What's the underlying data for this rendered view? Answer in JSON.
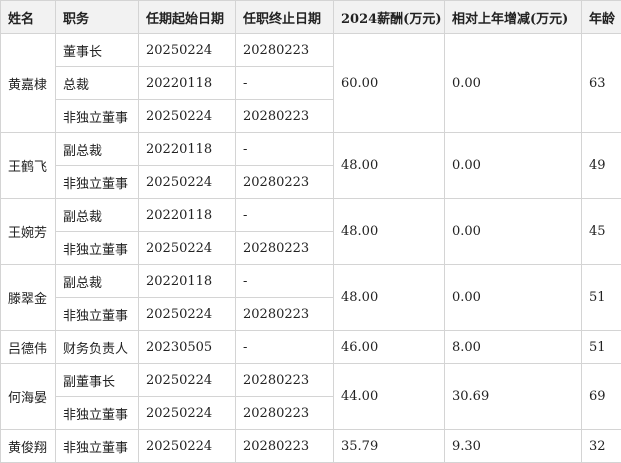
{
  "headers": {
    "name": "姓名",
    "position": "职务",
    "start": "任期起始日期",
    "end": "任职终止日期",
    "salary": "2024薪酬(万元)",
    "change": "相对上年增减(万元)",
    "age": "年龄"
  },
  "executives": [
    {
      "name": "黄嘉棣",
      "salary": "60.00",
      "change": "0.00",
      "age": "63",
      "roles": [
        {
          "position": "董事长",
          "start": "20250224",
          "end": "20280223"
        },
        {
          "position": "总裁",
          "start": "20220118",
          "end": "-"
        },
        {
          "position": "非独立董事",
          "start": "20250224",
          "end": "20280223"
        }
      ]
    },
    {
      "name": "王鹤飞",
      "salary": "48.00",
      "change": "0.00",
      "age": "49",
      "roles": [
        {
          "position": "副总裁",
          "start": "20220118",
          "end": "-"
        },
        {
          "position": "非独立董事",
          "start": "20250224",
          "end": "20280223"
        }
      ]
    },
    {
      "name": "王婉芳",
      "salary": "48.00",
      "change": "0.00",
      "age": "45",
      "roles": [
        {
          "position": "副总裁",
          "start": "20220118",
          "end": "-"
        },
        {
          "position": "非独立董事",
          "start": "20250224",
          "end": "20280223"
        }
      ]
    },
    {
      "name": "滕翠金",
      "salary": "48.00",
      "change": "0.00",
      "age": "51",
      "roles": [
        {
          "position": "副总裁",
          "start": "20220118",
          "end": "-"
        },
        {
          "position": "非独立董事",
          "start": "20250224",
          "end": "20280223"
        }
      ]
    },
    {
      "name": "吕德伟",
      "salary": "46.00",
      "change": "8.00",
      "age": "51",
      "roles": [
        {
          "position": "财务负责人",
          "start": "20230505",
          "end": "-"
        }
      ]
    },
    {
      "name": "何海晏",
      "salary": "44.00",
      "change": "30.69",
      "age": "69",
      "roles": [
        {
          "position": "副董事长",
          "start": "20250224",
          "end": "20280223"
        },
        {
          "position": "非独立董事",
          "start": "20250224",
          "end": "20280223"
        }
      ]
    },
    {
      "name": "黄俊翔",
      "salary": "35.79",
      "change": "9.30",
      "age": "32",
      "roles": [
        {
          "position": "非独立董事",
          "start": "20250224",
          "end": "20280223"
        }
      ]
    }
  ]
}
